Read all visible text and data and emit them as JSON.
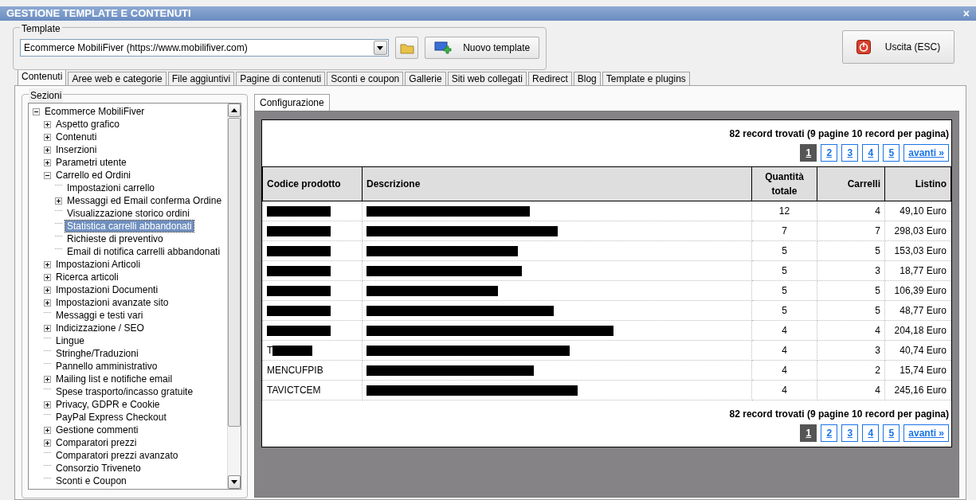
{
  "window": {
    "title": "GESTIONE TEMPLATE E CONTENUTI",
    "close": "×"
  },
  "template": {
    "legend": "Template",
    "value": "Ecommerce MobiliFiver (https://www.mobilifiver.com)",
    "new_button": "Nuovo template"
  },
  "exit_button": "Uscita (ESC)",
  "tabs": [
    {
      "label": "Contenuti",
      "selected": true
    },
    {
      "label": "Aree web e categorie",
      "selected": false
    },
    {
      "label": "File aggiuntivi",
      "selected": false
    },
    {
      "label": "Pagine di contenuti",
      "selected": false
    },
    {
      "label": "Sconti e coupon",
      "selected": false
    },
    {
      "label": "Gallerie",
      "selected": false
    },
    {
      "label": "Siti web collegati",
      "selected": false
    },
    {
      "label": "Redirect",
      "selected": false
    },
    {
      "label": "Blog",
      "selected": false
    },
    {
      "label": "Template e plugins",
      "selected": false
    }
  ],
  "sidebar": {
    "legend": "Sezioni",
    "items": [
      {
        "label": "Ecommerce MobiliFiver",
        "kind": "node",
        "expanded": true,
        "selected": false,
        "children": [
          {
            "label": "Aspetto grafico",
            "kind": "node",
            "expanded": false,
            "selected": false
          },
          {
            "label": "Contenuti",
            "kind": "node",
            "expanded": false,
            "selected": false
          },
          {
            "label": "Inserzioni",
            "kind": "node",
            "expanded": false,
            "selected": false
          },
          {
            "label": "Parametri utente",
            "kind": "node",
            "expanded": false,
            "selected": false
          },
          {
            "label": "Carrello ed Ordini",
            "kind": "node",
            "expanded": true,
            "selected": false,
            "children": [
              {
                "label": "Impostazioni carrello",
                "kind": "leaf",
                "selected": false
              },
              {
                "label": "Messaggi ed Email conferma Ordine",
                "kind": "node",
                "expanded": false,
                "selected": false
              },
              {
                "label": "Visualizzazione storico ordini",
                "kind": "leaf",
                "selected": false
              },
              {
                "label": "Statistica carrelli abbandonati",
                "kind": "leaf",
                "selected": true
              },
              {
                "label": "Richieste di preventivo",
                "kind": "leaf",
                "selected": false
              },
              {
                "label": "Email di notifica carrelli abbandonati",
                "kind": "leaf",
                "selected": false
              }
            ]
          },
          {
            "label": "Impostazioni Articoli",
            "kind": "node",
            "expanded": false,
            "selected": false
          },
          {
            "label": "Ricerca articoli",
            "kind": "node",
            "expanded": false,
            "selected": false
          },
          {
            "label": "Impostazioni Documenti",
            "kind": "node",
            "expanded": false,
            "selected": false
          },
          {
            "label": "Impostazioni avanzate sito",
            "kind": "node",
            "expanded": false,
            "selected": false
          },
          {
            "label": "Messaggi e testi vari",
            "kind": "leaf",
            "selected": false
          },
          {
            "label": "Indicizzazione / SEO",
            "kind": "node",
            "expanded": false,
            "selected": false
          },
          {
            "label": "Lingue",
            "kind": "leaf",
            "selected": false
          },
          {
            "label": "Stringhe/Traduzioni",
            "kind": "leaf",
            "selected": false
          },
          {
            "label": "Pannello amministrativo",
            "kind": "leaf",
            "selected": false
          },
          {
            "label": "Mailing list e notifiche email",
            "kind": "node",
            "expanded": false,
            "selected": false
          },
          {
            "label": "Spese trasporto/incasso gratuite",
            "kind": "leaf",
            "selected": false
          },
          {
            "label": "Privacy, GDPR e Cookie",
            "kind": "node",
            "expanded": false,
            "selected": false
          },
          {
            "label": "PayPal Express Checkout",
            "kind": "leaf",
            "selected": false
          },
          {
            "label": "Gestione commenti",
            "kind": "node",
            "expanded": false,
            "selected": false
          },
          {
            "label": "Comparatori prezzi",
            "kind": "node",
            "expanded": false,
            "selected": false
          },
          {
            "label": "Comparatori prezzi avanzato",
            "kind": "leaf",
            "selected": false
          },
          {
            "label": "Consorzio Triveneto",
            "kind": "leaf",
            "selected": false
          },
          {
            "label": "Sconti e Coupon",
            "kind": "leaf",
            "selected": false
          }
        ]
      }
    ]
  },
  "inner_tabs": [
    {
      "label": "Configurazione",
      "selected": true
    }
  ],
  "summary_top": "82 record trovati (9 pagine 10 record per pagina)",
  "pages_top": [
    {
      "label": "1",
      "selected": true
    },
    {
      "label": "2",
      "selected": false
    },
    {
      "label": "3",
      "selected": false
    },
    {
      "label": "4",
      "selected": false
    },
    {
      "label": "5",
      "selected": false
    },
    {
      "label": "avanti »",
      "selected": false
    }
  ],
  "table": {
    "columns": [
      "Codice prodotto",
      "Descrizione",
      "Quantità totale",
      "Carrelli",
      "Listino"
    ],
    "rows": [
      {
        "code": "",
        "code_redacted": true,
        "description_redacted": true,
        "quantity": "12",
        "carts": "4",
        "price": "49,10 Euro"
      },
      {
        "code": "",
        "code_redacted": true,
        "description_redacted": true,
        "quantity": "7",
        "carts": "7",
        "price": "298,03 Euro"
      },
      {
        "code": "",
        "code_redacted": true,
        "description_redacted": true,
        "quantity": "5",
        "carts": "5",
        "price": "153,03 Euro"
      },
      {
        "code": "",
        "code_redacted": true,
        "description_redacted": true,
        "quantity": "5",
        "carts": "3",
        "price": "18,77 Euro"
      },
      {
        "code": "",
        "code_redacted": true,
        "description_redacted": true,
        "quantity": "5",
        "carts": "5",
        "price": "106,39 Euro"
      },
      {
        "code": "",
        "code_redacted": true,
        "description_redacted": true,
        "quantity": "5",
        "carts": "5",
        "price": "48,77 Euro"
      },
      {
        "code": "",
        "code_redacted": true,
        "description_redacted": true,
        "quantity": "4",
        "carts": "4",
        "price": "204,18 Euro"
      },
      {
        "code": "T",
        "code_redacted": true,
        "description_redacted": true,
        "quantity": "4",
        "carts": "3",
        "price": "40,74 Euro"
      },
      {
        "code": "MENCUFPIB",
        "code_redacted": false,
        "description_redacted": true,
        "quantity": "4",
        "carts": "2",
        "price": "15,74 Euro"
      },
      {
        "code": "TAVICTCEM",
        "code_redacted": false,
        "description_redacted": true,
        "quantity": "4",
        "carts": "4",
        "price": "245,16 Euro"
      }
    ]
  },
  "summary_bottom": "82 record trovati (9 pagine 10 record per pagina)",
  "pages_bottom": [
    {
      "label": "1",
      "selected": true
    },
    {
      "label": "2",
      "selected": false
    },
    {
      "label": "3",
      "selected": false
    },
    {
      "label": "4",
      "selected": false
    },
    {
      "label": "5",
      "selected": false
    },
    {
      "label": "avanti »",
      "selected": false
    }
  ]
}
